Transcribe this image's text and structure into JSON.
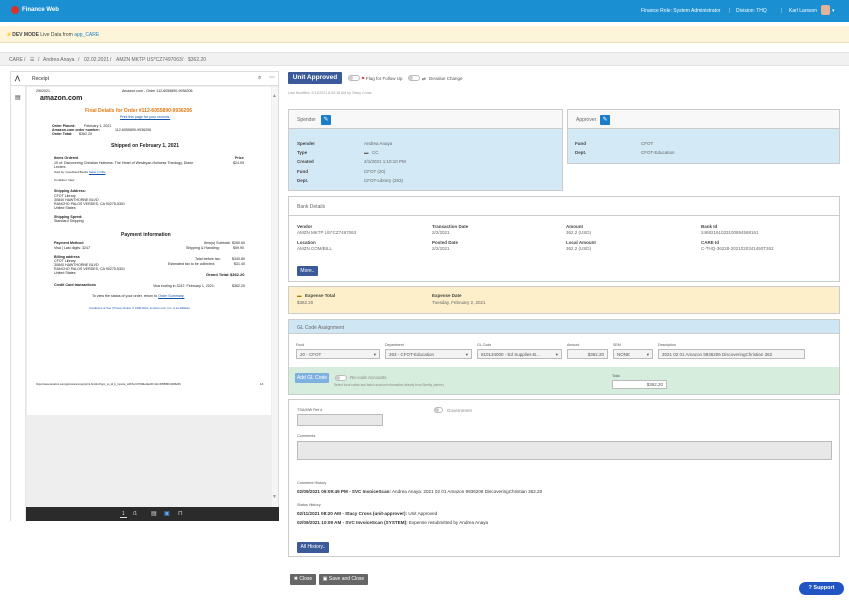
{
  "topbar": {
    "brand": "Finance Web",
    "role": "Finance Role: System Administrator",
    "division": "Division: THQ",
    "user": "Karl Larsson",
    "sep": "|",
    "caret": "▾"
  },
  "devbar": {
    "label": "DEV MODE",
    "text": "Live Data from",
    "link": "app_CARE"
  },
  "breadcrumb": {
    "items": [
      "CARE",
      "/",
      "☰",
      "/",
      "Andrea Anaya",
      "/",
      "02.02.2021",
      "/",
      "AMZN MKTP US*CZ7497063",
      "/",
      "$362.20"
    ]
  },
  "viewer": {
    "title": "Receipt",
    "page": {
      "date": "2/6/2021",
      "header_right": "Amazon.com - Order 112-6055890-9936206",
      "logo": "amazon.com",
      "final_details": "Final Details for Order #112-6055890-9936206",
      "print_link": "Print this page for your records.",
      "order_placed_label": "Order Placed:",
      "order_placed": "February 1, 2021",
      "order_number_label": "Amazon.com order number:",
      "order_number": "112-6055890-9936206",
      "order_total_label": "Order Total:",
      "order_total": "$362.20",
      "shipped_heading": "Shipped on February 1, 2021",
      "items_ordered": "Items Ordered",
      "price_label": "Price",
      "item": "15 of: Discovering Christian Holiness: The Heart of Wesleyan-Holiness Theology, Diane",
      "item2": "Leclerc",
      "price": "$24.09",
      "sold_by": "Sold by: Goodfood Books",
      "sold_by_link": "Seller profile",
      "condition": "Condition: New",
      "ship_addr_label": "Shipping Address:",
      "ship_addr": [
        "CFOT Library",
        "30840 HAWTHORNE BLVD",
        "RANCHO PALOS VERDES, CA 90275-5301",
        "United States"
      ],
      "ship_speed_label": "Shipping Speed:",
      "ship_speed": "Standard Shipping",
      "payment_heading": "Payment information",
      "pm_label": "Payment Method:",
      "pm": "Visa | Last digits: 3247",
      "billing_label": "Billing address",
      "billing": [
        "CFOT Library",
        "30840 HAWTHORNE BLVD",
        "RANCHO PALOS VERDES, CA 90275-5301",
        "United States"
      ],
      "cc_label": "Credit Card transactions",
      "sums": [
        [
          "Item(s) Subtotal:",
          "$280.60"
        ],
        [
          "Shipping & Handling:",
          "$59.90"
        ],
        [
          "",
          ""
        ],
        [
          "Total before tax:",
          "$340.80"
        ],
        [
          "Estimated tax to be collected:",
          "$31.40"
        ]
      ],
      "grand_total_label": "Grand Total:",
      "grand_total": "$362.20",
      "cc_line": "Visa ending in 3247: February 1, 2021:",
      "cc_amt": "$362.20",
      "status_line": "To view the status of your order, return to",
      "status_link": "Order Summary.",
      "footer": "Conditions of Use | Privacy Notice © 1996-2021, Amazon.com, Inc. or its affiliates",
      "url": "https://www.amazon.com/gp/css/summary/print.html/ref=ppx_yo_dt_b_invoice_o00?ie=UTF8&orderID=112-6055890-9936206",
      "pagenum": "1/1"
    },
    "pager": "1",
    "pager_total": "/1"
  },
  "status": {
    "badge": "Unit Approved",
    "followup": "Flag for Follow Up",
    "devalue": "Devalue Change",
    "modified": "Last Modified: 2/11/2021 8:20:18 AM by Stacy Cross"
  },
  "spender": {
    "header": "Spender",
    "rows": [
      [
        "Spender",
        "Andrea Anaya"
      ],
      [
        "Type",
        "CC"
      ],
      [
        "Created",
        "2/1/2021 1:10:10 PM"
      ],
      [
        "Fund",
        "CFOT (20)"
      ],
      [
        "Dept.",
        "CFOT-Library (263)"
      ]
    ]
  },
  "approver": {
    "header": "Approver",
    "rows": [
      [
        "Fund",
        "CFOT"
      ],
      [
        "Dept.",
        "CFOT-Education"
      ]
    ]
  },
  "bank": {
    "header": "Bank Details",
    "vendor_label": "Vendor",
    "vendor": "AMZN MKTP US*CZ7497063",
    "location_label": "Location",
    "location": "AMZN.COM/BILL",
    "tdate_label": "Transaction Date",
    "tdate": "2/2/2021",
    "pdate_label": "Posted Date",
    "pdate": "2/2/2021",
    "amount_label": "Amount",
    "amount": "362.2 (USD)",
    "local_label": "Local Amount",
    "local": "362.2 (USD)",
    "bankid_label": "Bank Id",
    "bankid": "24692161033100894588161",
    "careid_label": "CARE Id",
    "careid": "C-THQ-36228-2021020341450T263",
    "more": "More.."
  },
  "expense": {
    "total_label": "Expense Total",
    "total": "$362.20",
    "date_label": "Expense Date",
    "date": "Tuesday, February 2, 2021"
  },
  "gl": {
    "header": "GL Code Assignment",
    "fund_label": "Fund",
    "fund": "20 - CFOT",
    "dept_label": "Department",
    "dept": "263 - CFOT-Education",
    "code_label": "GL Code",
    "code": "810134000 - Ed Supplies-B...",
    "amt_label": "Amount",
    "amt": "$362.20",
    "sem_label": "SEM",
    "sem": "NONE",
    "desc_label": "Description",
    "desc": "2021 02 01 Amazon 9936206 DiscoveringChristian 362",
    "add_btn": "Add GL Code",
    "recode": "Re-code Accounts",
    "recode_note": "Select local codes and batch account information directly from Shelby (above)",
    "total_label": "Total",
    "total": "$362.20"
  },
  "misc": {
    "tsa_label": "TSA/MW Ref #",
    "gov_label": "Government",
    "comments_label": "Comments",
    "comment_hist": "Comment History",
    "comment_line_b": "02/09/2021 06:09:49 PM - SVC InvoiceScan:",
    "comment_line": " Andrea Anaya: 2021 02 01 Amazon 9936206 DiscoveringChristian 362.20",
    "status_hist": "Status History",
    "s1_b": "02/11/2021 08:20 AM - Stacy Cross (unit-approver):",
    "s1": " Unit Approved",
    "s2_b": "02/09/2021 10:09 AM - SVC InvoiceScan (SYSTEM):",
    "s2": " Expense resubmitted by Andrea Anaya",
    "all_history": "All History.."
  },
  "footer": {
    "close": "Close",
    "save_close": "Save and Close"
  },
  "support": "Support"
}
